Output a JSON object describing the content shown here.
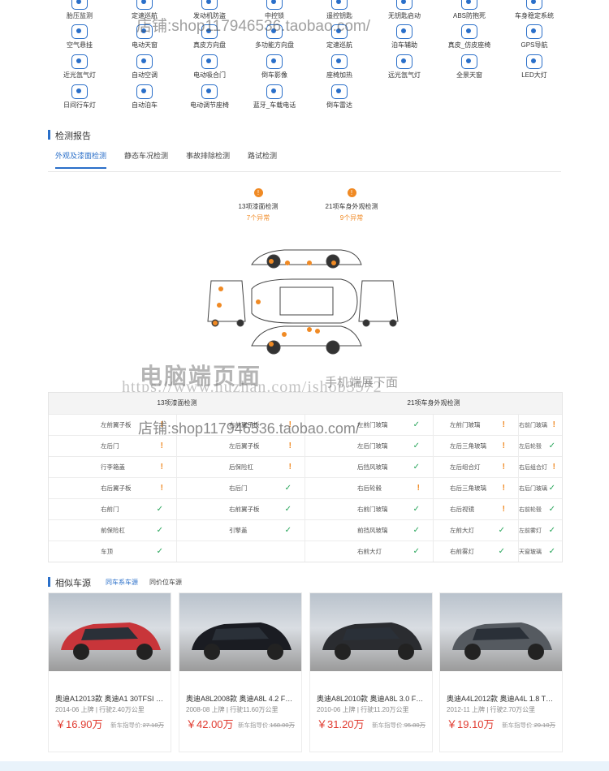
{
  "features_row0": [
    "胎压监测",
    "定速巡航",
    "发动机防盗",
    "中控锁",
    "遥控钥匙",
    "无钥匙启动",
    "ABS防抱死",
    "车身稳定系统"
  ],
  "features_row1": [
    "空气悬挂",
    "电动天窗",
    "真皮方向盘",
    "多功能方向盘",
    "定速巡航",
    "泊车辅助",
    "真皮_仿皮座椅",
    "GPS导航"
  ],
  "features_row2": [
    "近光氙气灯",
    "自动空调",
    "电动吸合门",
    "倒车影像",
    "座椅加热",
    "远光氙气灯",
    "全景天窗",
    "LED大灯"
  ],
  "features_row3": [
    "日间行车灯",
    "自动泊车",
    "电动调节座椅",
    "蓝牙_车载电话",
    "倒车雷达"
  ],
  "report": {
    "title": "检测报告",
    "tabs": [
      "外观及漆面检测",
      "静态车况检测",
      "事故排除检测",
      "路试检测"
    ],
    "summary_left": {
      "label": "13项漆面检测",
      "count": "7个异常"
    },
    "summary_right": {
      "label": "21项车身外观检测",
      "count": "9个异常"
    },
    "table_header": [
      "13项漆面检测",
      "21项车身外观检测"
    ],
    "rows": [
      [
        [
          "左前翼子板",
          "!"
        ],
        [
          "右前翼子板",
          "!"
        ],
        [
          "左前门玻璃",
          "✓"
        ],
        [
          "左前门玻璃",
          "!"
        ]
      ],
      [
        [
          "左后门",
          "!"
        ],
        [
          "左后翼子板",
          "!"
        ],
        [
          "左后门玻璃",
          "✓"
        ],
        [
          "左后三角玻璃",
          "!"
        ]
      ],
      [
        [
          "行李箱盖",
          "!"
        ],
        [
          "后保险杠",
          "!"
        ],
        [
          "后挡风玻璃",
          "✓"
        ],
        [
          "左后组合灯",
          "!"
        ]
      ],
      [
        [
          "右后翼子板",
          "!"
        ],
        [
          "右后门",
          "✓"
        ],
        [
          "右后轮毂",
          "!"
        ],
        [
          "右后三角玻璃",
          "!"
        ]
      ],
      [
        [
          "右前门",
          "✓"
        ],
        [
          "右前翼子板",
          "✓"
        ],
        [
          "右前门玻璃",
          "✓"
        ],
        [
          "右后视镜",
          "!"
        ]
      ],
      [
        [
          "前保险杠",
          "✓"
        ],
        [
          "引擎盖",
          "✓"
        ],
        [
          "前挡风玻璃",
          "✓"
        ],
        [
          "左前大灯",
          "✓"
        ]
      ],
      [
        [
          "车顶",
          "✓"
        ],
        [
          "",
          ""
        ],
        [
          "右前大灯",
          "✓"
        ],
        [
          "右前雾灯",
          "✓"
        ]
      ]
    ],
    "col5": [
      [
        "右前门玻璃",
        "!"
      ],
      [
        "左后轮毂",
        "✓"
      ],
      [
        "右后组合灯",
        "!"
      ],
      [
        "右后门玻璃",
        "✓"
      ],
      [
        "右前轮毂",
        "✓"
      ],
      [
        "左前雾灯",
        "✓"
      ],
      [
        "天窗玻璃",
        "✓"
      ]
    ]
  },
  "similar": {
    "title": "相似车源",
    "tabs": [
      "同车系车源",
      "同价位车源"
    ],
    "cards": [
      {
        "title": "奥迪A12013款 奥迪A1 30TFSI Eg...",
        "date": "2014-06 上牌",
        "mileage": "行驶2.40万公里",
        "price": "￥16.90万",
        "orig_label": "新车指导价:",
        "orig": "27.18万",
        "color": "#c8353a"
      },
      {
        "title": "奥迪A8L2008款 奥迪A8L 4.2 FSI ...",
        "date": "2008-08 上牌",
        "mileage": "行驶11.60万公里",
        "price": "￥42.00万",
        "orig_label": "新车指导价:",
        "orig": "168.00万",
        "color": "#1a1c22"
      },
      {
        "title": "奥迪A8L2010款 奥迪A8L 3.0 FSI ...",
        "date": "2010-06 上牌",
        "mileage": "行驶11.20万公里",
        "price": "￥31.20万",
        "orig_label": "新车指导价:",
        "orig": "95.80万",
        "color": "#2a2c30"
      },
      {
        "title": "奥迪A4L2012款 奥迪A4L 1.8 TFS...",
        "date": "2012-11 上牌",
        "mileage": "行驶2.70万公里",
        "price": "￥19.10万",
        "orig_label": "新车指导价:",
        "orig": "29.10万",
        "color": "#555a60"
      }
    ]
  },
  "watermarks": {
    "top": "店铺:shop117946536.taobao.com/",
    "mid": "店铺:shop117946536.taobao.com/",
    "big": "电脑端页面",
    "small": "手机端展下面",
    "url": "https://www.huzhan.com/ishop3572"
  },
  "colors": {
    "accent": "#2a6fc9",
    "warn": "#f08a24",
    "ok": "#27a55a",
    "price": "#e03a2f"
  }
}
